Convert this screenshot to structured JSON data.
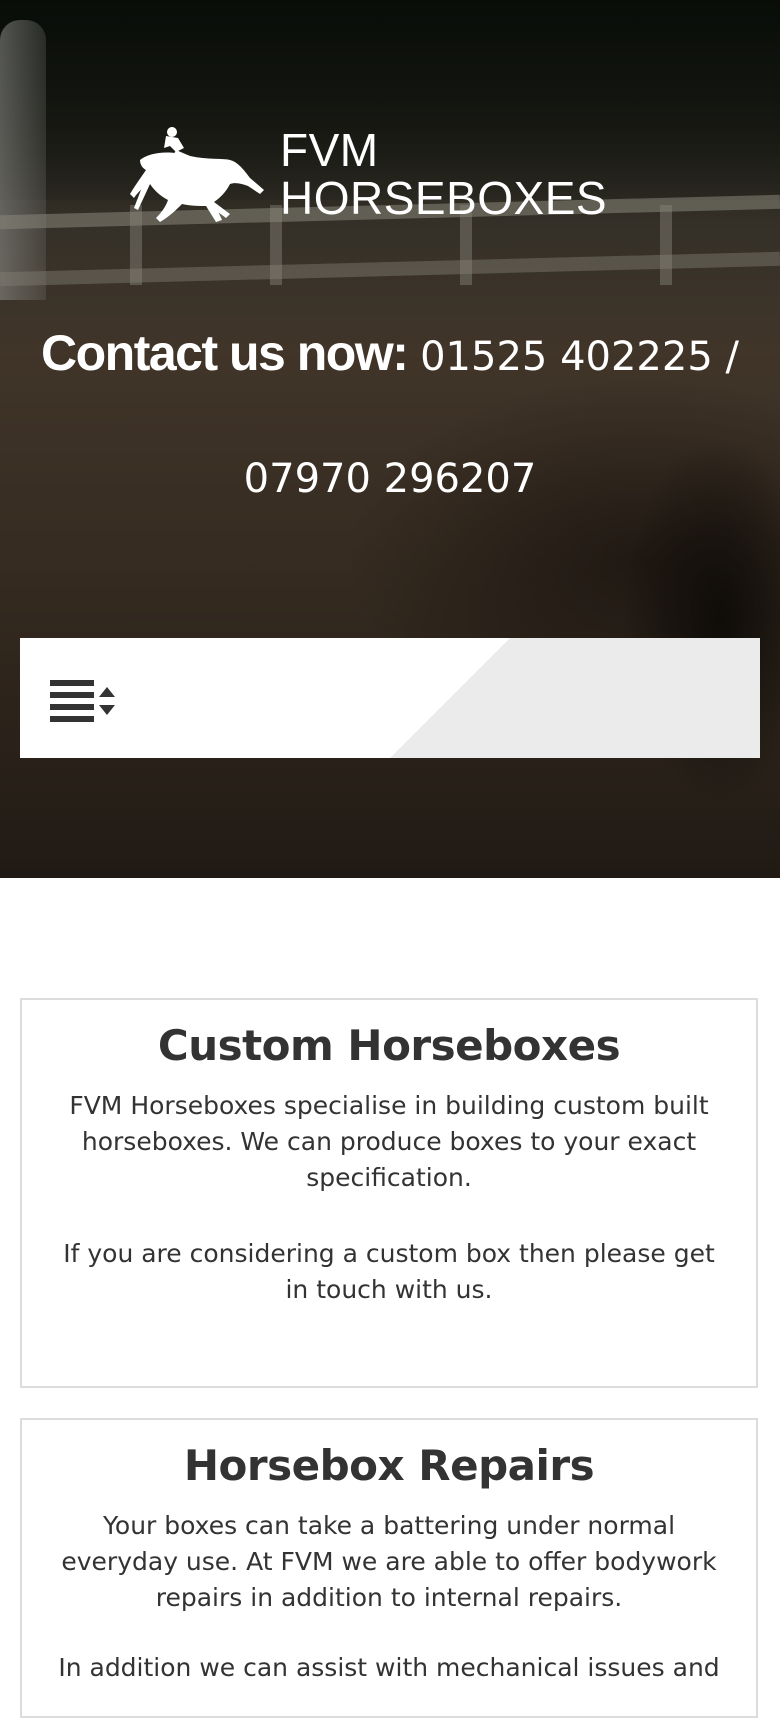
{
  "header": {
    "logo": {
      "line1": "FVM",
      "line2": "HORSEBOXES",
      "icon": "horse-jockey-icon"
    },
    "contact": {
      "label": "Contact us now:",
      "phones": "01525 402225 / 07970 296207"
    }
  },
  "nav": {
    "menu_icon": "menu-sort-icon"
  },
  "sections": [
    {
      "title": "Custom Horseboxes",
      "paragraphs": [
        "FVM Horseboxes specialise in building custom built horseboxes. We can produce boxes to your exact specification.",
        "If you are considering a custom box then please get in touch with us."
      ]
    },
    {
      "title": "Horsebox Repairs",
      "paragraphs": [
        "Your boxes can take a battering under normal everyday use. At FVM we are able to offer bodywork repairs in addition to internal repairs.",
        "In addition we can assist with mechanical issues and"
      ]
    }
  ],
  "colors": {
    "text": "#333333",
    "card_border": "#dcdcdc",
    "nav_bg": "#ffffff",
    "nav_accent": "#ebebeb"
  }
}
